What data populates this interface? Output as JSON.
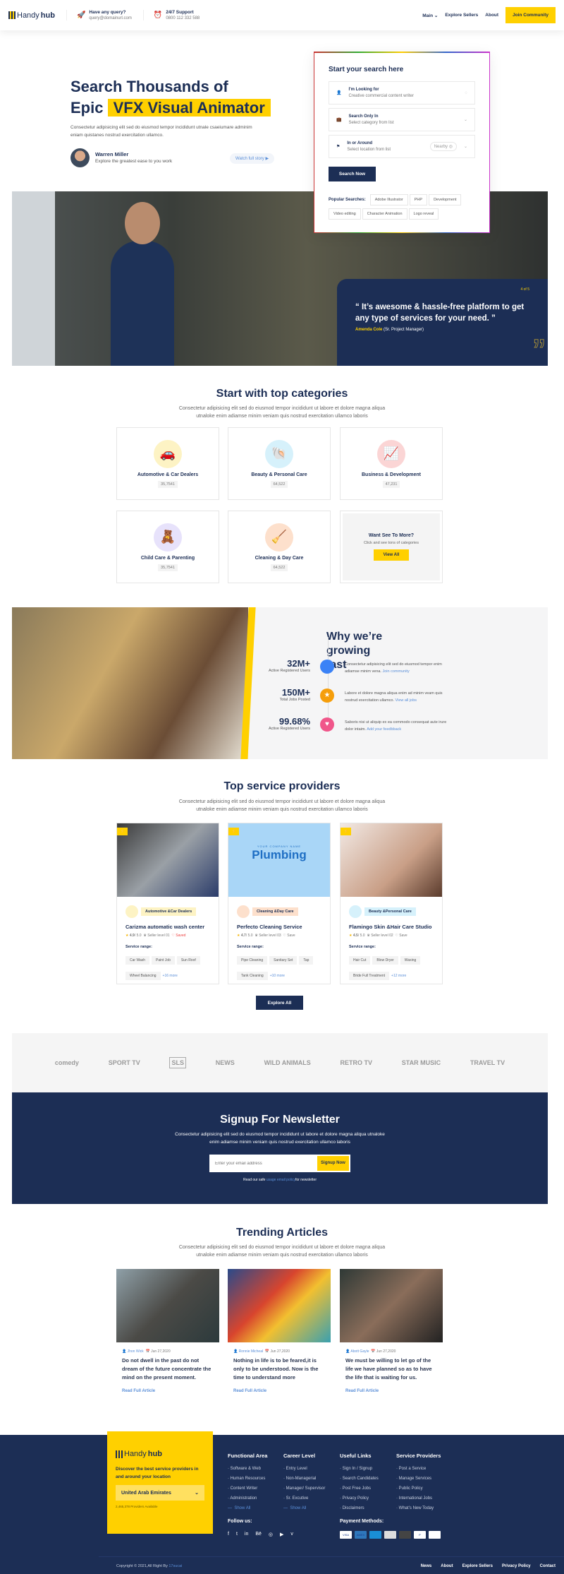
{
  "header": {
    "logo": "Handyhub",
    "logo_bold": "hub",
    "logo_light": "Handy",
    "query_title": "Have any query?",
    "query_email": "query@domainurl.com",
    "support_title": "24/7 Support",
    "support_phone": "0800 112 332 588",
    "nav": [
      "Main",
      "Explore Sellers",
      "About"
    ],
    "join": "Join Community"
  },
  "hero": {
    "title_line1": "Search Thousands of",
    "title_epic": "Epic",
    "title_highlight": "VFX Visual Animator",
    "desc": "Consectetur adipisicing elit sed do eiusmod tempor incididunt utnale csaeiumare adminim eniam quistanes nostrud exercitation ullamco.",
    "person_name": "Warren Miller",
    "person_sub": "Explore the greatest ease to you work",
    "watch": "Watch full story"
  },
  "search": {
    "title": "Start your search here",
    "fields": [
      {
        "label": "I'm Looking for",
        "value": "Creative commercial content writer"
      },
      {
        "label": "Search Only In",
        "value": "Select category from list"
      },
      {
        "label": "In or Around",
        "value": "Select location from list",
        "extra": "Nearby"
      }
    ],
    "button": "Search Now",
    "popular_label": "Popular Searches:",
    "popular": [
      "Adobe Illustrator",
      "PHP",
      "Development",
      "Video editing",
      "Character Animation",
      "Logo reveal"
    ]
  },
  "testimonial": {
    "counter": "4 of 5",
    "quote": "“ It’s awesome & hassle-free platform to get any type of services for your need. ”",
    "author": "Amenda Cole",
    "role": "(Sr. Project Manager)"
  },
  "categories": {
    "title": "Start with top categories",
    "sub": "Consectetur adipisicing elit sed do eiusmod tempor incididunt ut labore et dolore magna aliqua utnaloke enim adiamse minim veniam quis nostrud exercitation ullamco laboris",
    "items": [
      {
        "name": "Automotive & Car Dealers",
        "count": "35,7541",
        "color": "#fdf3c4",
        "icon": "🚗"
      },
      {
        "name": "Beauty & Personal Care",
        "count": "64,522",
        "color": "#d6f1fb",
        "icon": "🐚"
      },
      {
        "name": "Business & Development",
        "count": "47,231",
        "color": "#fbd5d5",
        "icon": "📈"
      },
      {
        "name": "Child Care & Parenting",
        "count": "35,7541",
        "color": "#e7e2fb",
        "icon": "🧸"
      },
      {
        "name": "Cleaning & Day Care",
        "count": "64,522",
        "color": "#fde0cc",
        "icon": "🧹"
      }
    ],
    "more_title": "Want See To More?",
    "more_sub": "Click and see tons of categories",
    "more_button": "View All"
  },
  "growth": {
    "title": "Why we’re growing fast",
    "stats": [
      {
        "value": "32M+",
        "label": "Active Registered Users",
        "text": "Consectetur adipisicing elit sed do eiusmod tempor enim adiamse minim vena.",
        "link": "Join community",
        "color": "#3b82f6"
      },
      {
        "value": "150M+",
        "label": "Total Jobs Posted",
        "text": "Labore et dolore magna aliqua enim ad minim veam quis nostrud exercitation ullamco.",
        "link": "View all jobs",
        "color": "#f59e0b"
      },
      {
        "value": "99.68%",
        "label": "Active Registered Users",
        "text": "Saboris nisi ut aliquip ex ea commodo consequat aute irure dolor intaim.",
        "link": "Add your feedbback",
        "color": "#f0568a"
      }
    ]
  },
  "providers": {
    "title": "Top service providers",
    "sub": "Consectetur adipisicing elit sed do eiusmod tempor incididunt ut labore et dolore magna aliqua utnaloke enim adiamse minim veniam quis nostrud exercitation ullamco laboris",
    "items": [
      {
        "category": "Automotive &Car Dealers",
        "cat_color": "#fdf3c4",
        "name": "Carizma automatic wash center",
        "rating": "4.9",
        "of": "/ 5.0",
        "level": "Seller level 01",
        "save": "Saved",
        "range": [
          "Car Wash",
          "Paint Job",
          "Sun Roof",
          "Wheel Balancing"
        ],
        "more": "+16 more"
      },
      {
        "category": "Cleaning &Day Care",
        "cat_color": "#fde0cc",
        "name": "Perfecto Cleaning Service",
        "rating": "4.7",
        "of": "/ 5.0",
        "level": "Seller level 03",
        "save": "Save",
        "range": [
          "Pipe Cleaning",
          "Sanitary Set",
          "Tap",
          "Tank Cleaning"
        ],
        "more": "+10 more",
        "image_text_small": "YOUR COMPANY NAME",
        "image_text": "Plumbing"
      },
      {
        "category": "Beauty &Personal Care",
        "cat_color": "#d6f1fb",
        "name": "Flamingo Skin &Hair Care Studio",
        "rating": "4.5",
        "of": "/ 5.0",
        "level": "Seller level 02",
        "save": "Save",
        "range": [
          "Hair Cut",
          "Blow Dryer",
          "Waxing",
          "Bride Full Treatment"
        ],
        "more": "+12 more"
      }
    ],
    "range_label": "Service range:",
    "explore": "Explore All"
  },
  "logos": [
    "comedy",
    "SPORT TV",
    "SLS",
    "NEWS",
    "WILD ANIMALS",
    "RETRO TV",
    "STAR MUSIC",
    "TRAVEL TV"
  ],
  "newsletter": {
    "title": "Signup For Newsletter",
    "sub": "Consectetur adipisicing elit sed do eiusmod tempor incididunt ut labore et dolore magna aliqua utnaloke enim adiamse minim veniam quis nostrud exercitation ullamco laboris",
    "placeholder": "Enter your email address",
    "button": "Signup Now",
    "note_pre": "Read our safe ",
    "note_link": "usage email policy",
    "note_post": "for newsletter"
  },
  "articles": {
    "title": "Trending Articles",
    "sub": "Consectetur adipisicing elit sed do eiusmod tempor incididunt ut labore et dolore magna aliqua utnaloke enim adiamse minim veniam quis nostrud exercitation ullamco laboris",
    "read": "Read Full Article",
    "items": [
      {
        "author": "Jhon Wick",
        "date": "Jun 27,2020",
        "title": "Do not dwell in the past do not dream of the future concentrate the mind on the present moment."
      },
      {
        "author": "Ronnie Micheal",
        "date": "Jun 27,2020",
        "title": "Nothing in life is to be feared,it is only to be understood. Now is the time to understand more"
      },
      {
        "author": "Abott Gayle",
        "date": "Jun 27,2020",
        "title": "We must be willing to let go of the life we have planned so as to have the life that is waiting for us."
      }
    ]
  },
  "footer": {
    "tagline": "Discover the best service providers in and around your location",
    "country": "United Arab Emirates",
    "providers": "2,465,378 Providers Available",
    "columns": [
      {
        "title": "Functional Area",
        "items": [
          "Software & Web",
          "Human Resources",
          "Content Writer",
          "Administration"
        ],
        "show_all": "Show All"
      },
      {
        "title": "Career Level",
        "items": [
          "Entry Level",
          "Non-Managerial",
          "Manager/ Supervisor",
          "Sr. Excutive"
        ],
        "show_all": "Show All"
      },
      {
        "title": "Useful Links",
        "items": [
          "Sign In / Signup",
          "Search Candidates",
          "Post Free Jobs",
          "Privacy Policy",
          "Disclaimers"
        ]
      },
      {
        "title": "Service Providers",
        "items": [
          "Post a Service",
          "Manage Services",
          "Public Policy",
          "International Jobs",
          "What’s New Today"
        ]
      }
    ],
    "follow": "Follow us:",
    "social": [
      "f",
      "t",
      "in",
      "Bē",
      "◎",
      "▶",
      "v"
    ],
    "payment": "Payment Methods:",
    "cards": [
      "VISA",
      "AMEX",
      "",
      "",
      "",
      "P",
      ""
    ],
    "copyright": "Copyright © 2021,All Right By ",
    "copyright_link": "17sucai",
    "bottom_links": [
      "News",
      "About",
      "Explore Sellers",
      "Privacy Policy",
      "Contact"
    ]
  }
}
